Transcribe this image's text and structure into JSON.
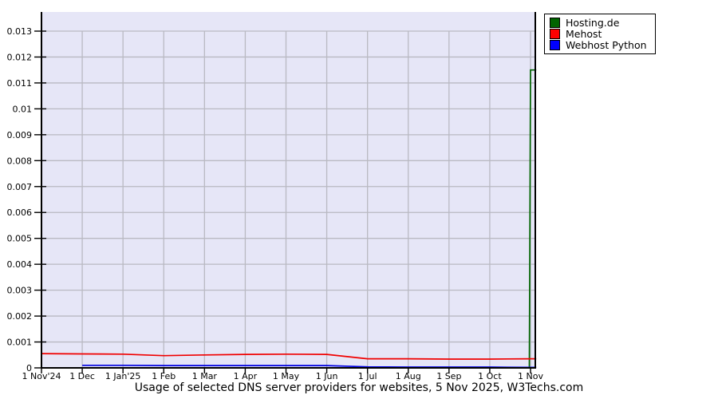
{
  "chart_title": "Usage of selected DNS server providers for websites, 5 Nov 2025, W3Techs.com",
  "legend": {
    "position": "top-right-outside",
    "items": [
      {
        "label": "Hosting.de",
        "color": "#006400"
      },
      {
        "label": "Mehost",
        "color": "#ff0000"
      },
      {
        "label": "Webhost Python",
        "color": "#0000ff"
      }
    ]
  },
  "colors": {
    "page_bg": "#ffffff",
    "plot_bg": "#e6e6f7",
    "gridline": "#b9b9c2",
    "axis": "#000000",
    "text": "#000000"
  },
  "chart_data": {
    "type": "line",
    "title": "Usage of selected DNS server providers for websites, 5 Nov 2025, W3Techs.com",
    "x_unit": "months since 1 Nov 2024 (12 = 1 Nov 2025, 12.14 = 5 Nov 2025 plot edge)",
    "x_axis": {
      "tick_labels": [
        "1 Nov'24",
        "1 Dec",
        "1 Jan'25",
        "1 Feb",
        "1 Mar",
        "1 Apr",
        "1 May",
        "1 Jun",
        "1 Jul",
        "1 Aug",
        "1 Sep",
        "1 Oct",
        "1 Nov"
      ]
    },
    "y_axis": {
      "ticks": [
        0,
        0.001,
        0.002,
        0.003,
        0.004,
        0.005,
        0.006,
        0.007,
        0.008,
        0.009,
        0.01,
        0.011,
        0.012,
        0.013
      ],
      "tick_labels": [
        "0",
        "0.001",
        "0.002",
        "0.003",
        "0.004",
        "0.005",
        "0.006",
        "0.007",
        "0.008",
        "0.009",
        "0.01",
        "0.011",
        "0.012",
        "0.013"
      ],
      "range": [
        0,
        0.0135
      ]
    },
    "grid": true,
    "legend_position": "top-right-outside",
    "series": [
      {
        "name": "Hosting.de",
        "color": "#006400",
        "summary": "approximately 0 all year, spikes to ~0.0115 at 1-5 Nov 2025 (right edge of plot)",
        "points": [
          {
            "x": 0,
            "y": 0
          },
          {
            "x": 11.97,
            "y": 0
          },
          {
            "x": 12,
            "y": 0.0115
          },
          {
            "x": 12.14,
            "y": 0.0115
          }
        ]
      },
      {
        "name": "Mehost",
        "color": "#f00000",
        "summary": "~0.00055 from Nov 2024 with slight dip near Feb, declines Jun-Jul 2025 to ~0.00035 and stays flat",
        "points": [
          {
            "x": 0,
            "y": 0.00055
          },
          {
            "x": 1,
            "y": 0.00054
          },
          {
            "x": 2,
            "y": 0.00053
          },
          {
            "x": 3,
            "y": 0.00047
          },
          {
            "x": 4,
            "y": 0.0005
          },
          {
            "x": 5,
            "y": 0.00052
          },
          {
            "x": 6,
            "y": 0.00053
          },
          {
            "x": 7,
            "y": 0.00052
          },
          {
            "x": 8,
            "y": 0.00035
          },
          {
            "x": 9,
            "y": 0.00035
          },
          {
            "x": 10,
            "y": 0.00034
          },
          {
            "x": 11,
            "y": 0.00034
          },
          {
            "x": 12,
            "y": 0.00035
          },
          {
            "x": 12.14,
            "y": 0.00035
          }
        ]
      },
      {
        "name": "Webhost Python",
        "color": "#0000e0",
        "summary": "~0.0001 from Dec 2024 to Jun 2025, declines to near 0 (~0.00002) from Jul 2025 onward",
        "points": [
          {
            "x": 1,
            "y": 0.0001
          },
          {
            "x": 2,
            "y": 0.0001
          },
          {
            "x": 3,
            "y": 9e-05
          },
          {
            "x": 4,
            "y": 9e-05
          },
          {
            "x": 5,
            "y": 9e-05
          },
          {
            "x": 6,
            "y": 9e-05
          },
          {
            "x": 7,
            "y": 9e-05
          },
          {
            "x": 8,
            "y": 4e-05
          },
          {
            "x": 9,
            "y": 3e-05
          },
          {
            "x": 10,
            "y": 3e-05
          },
          {
            "x": 11,
            "y": 3e-05
          },
          {
            "x": 12,
            "y": 2e-05
          },
          {
            "x": 12.14,
            "y": 2e-05
          }
        ]
      }
    ]
  }
}
